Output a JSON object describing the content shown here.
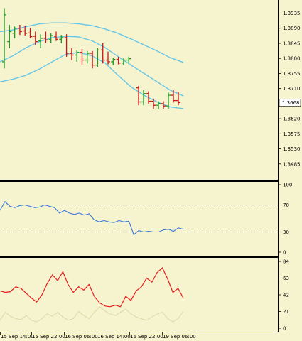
{
  "chart_data": [
    {
      "type": "ohlc",
      "panel": "price",
      "ylim": [
        1.344,
        1.397
      ],
      "y_ticks": [
        "1.3935",
        "1.3890",
        "1.3845",
        "1.3800",
        "1.3755",
        "1.3710",
        "1.3665",
        "1.3620",
        "1.3575",
        "1.3530",
        "1.3485"
      ],
      "y_tick_values": [
        1.3935,
        1.389,
        1.3845,
        1.38,
        1.3755,
        1.371,
        1.3665,
        1.362,
        1.3575,
        1.353,
        1.3485
      ],
      "current_price": "1.3668",
      "current_price_value": 1.3668,
      "colors": {
        "up": "#1f9a1f",
        "down": "#d31414",
        "band": "#69c7e6",
        "price_label_bg": "#ffffff"
      },
      "bars": [
        {
          "o": 1.379,
          "h": 1.395,
          "l": 1.377,
          "c": 1.393
        },
        {
          "o": 1.385,
          "h": 1.39,
          "l": 1.383,
          "c": 1.388
        },
        {
          "o": 1.3875,
          "h": 1.3895,
          "l": 1.386,
          "c": 1.389
        },
        {
          "o": 1.389,
          "h": 1.39,
          "l": 1.387,
          "c": 1.388
        },
        {
          "o": 1.3882,
          "h": 1.3898,
          "l": 1.3868,
          "c": 1.3875
        },
        {
          "o": 1.3876,
          "h": 1.389,
          "l": 1.386,
          "c": 1.3865
        },
        {
          "o": 1.3866,
          "h": 1.388,
          "l": 1.384,
          "c": 1.385
        },
        {
          "o": 1.3852,
          "h": 1.3872,
          "l": 1.383,
          "c": 1.386
        },
        {
          "o": 1.386,
          "h": 1.388,
          "l": 1.3846,
          "c": 1.3855
        },
        {
          "o": 1.3856,
          "h": 1.3875,
          "l": 1.3845,
          "c": 1.3868
        },
        {
          "o": 1.3866,
          "h": 1.388,
          "l": 1.3852,
          "c": 1.3857
        },
        {
          "o": 1.3857,
          "h": 1.387,
          "l": 1.3845,
          "c": 1.3862
        },
        {
          "o": 1.3862,
          "h": 1.3872,
          "l": 1.3805,
          "c": 1.3815
        },
        {
          "o": 1.3815,
          "h": 1.383,
          "l": 1.3795,
          "c": 1.381
        },
        {
          "o": 1.381,
          "h": 1.3825,
          "l": 1.379,
          "c": 1.3818
        },
        {
          "o": 1.3818,
          "h": 1.3828,
          "l": 1.378,
          "c": 1.3795
        },
        {
          "o": 1.3795,
          "h": 1.3822,
          "l": 1.3785,
          "c": 1.3815
        },
        {
          "o": 1.3815,
          "h": 1.3822,
          "l": 1.377,
          "c": 1.378
        },
        {
          "o": 1.378,
          "h": 1.383,
          "l": 1.3775,
          "c": 1.3825
        },
        {
          "o": 1.3825,
          "h": 1.3845,
          "l": 1.3785,
          "c": 1.3795
        },
        {
          "o": 1.3795,
          "h": 1.382,
          "l": 1.3782,
          "c": 1.379
        },
        {
          "o": 1.379,
          "h": 1.3802,
          "l": 1.378,
          "c": 1.3797
        },
        {
          "o": 1.3797,
          "h": 1.3805,
          "l": 1.3782,
          "c": 1.3786
        },
        {
          "o": 1.3786,
          "h": 1.38,
          "l": 1.378,
          "c": 1.3795
        },
        {
          "o": 1.3795,
          "h": 1.3805,
          "l": 1.3785,
          "c": 1.3799
        },
        {
          "o": 1.3712,
          "h": 1.3718,
          "l": 1.366,
          "c": 1.367
        },
        {
          "o": 1.367,
          "h": 1.3705,
          "l": 1.366,
          "c": 1.3695
        },
        {
          "o": 1.3695,
          "h": 1.3702,
          "l": 1.3665,
          "c": 1.3672
        },
        {
          "o": 1.3672,
          "h": 1.368,
          "l": 1.365,
          "c": 1.366
        },
        {
          "o": 1.366,
          "h": 1.3672,
          "l": 1.3648,
          "c": 1.3665
        },
        {
          "o": 1.3665,
          "h": 1.3672,
          "l": 1.365,
          "c": 1.3658
        },
        {
          "o": 1.3658,
          "h": 1.3698,
          "l": 1.365,
          "c": 1.369
        },
        {
          "o": 1.369,
          "h": 1.3705,
          "l": 1.3668,
          "c": 1.3674
        },
        {
          "o": 1.3674,
          "h": 1.37,
          "l": 1.366,
          "c": 1.3668
        }
      ],
      "bands": {
        "upper": [
          1.388,
          1.3885,
          1.3895,
          1.3903,
          1.3906,
          1.3906,
          1.3903,
          1.3898,
          1.3888,
          1.3875,
          1.3858,
          1.384,
          1.3822,
          1.3802,
          1.3788
        ],
        "middle": [
          1.379,
          1.3808,
          1.3832,
          1.385,
          1.3862,
          1.3866,
          1.3864,
          1.3853,
          1.3833,
          1.3806,
          1.378,
          1.3755,
          1.373,
          1.3705,
          1.3688
        ],
        "lower": [
          1.373,
          1.3738,
          1.375,
          1.3768,
          1.379,
          1.3812,
          1.3818,
          1.3808,
          1.3787,
          1.375,
          1.3715,
          1.369,
          1.367,
          1.3655,
          1.365
        ]
      }
    },
    {
      "type": "line",
      "panel": "indicator-1",
      "ylim": [
        0,
        100
      ],
      "y_ticks": [
        "100",
        "70",
        "30",
        "0"
      ],
      "y_tick_values": [
        100,
        70,
        30,
        0
      ],
      "levels": [
        70,
        30
      ],
      "series": [
        {
          "color": "#3a78d6",
          "values": [
            62,
            75,
            68,
            66,
            69,
            70,
            68,
            66,
            67,
            70,
            68,
            66,
            58,
            62,
            58,
            56,
            58,
            55,
            57,
            48,
            45,
            47,
            45,
            44,
            47,
            45,
            46,
            26,
            32,
            30,
            31,
            30,
            30,
            33,
            34,
            31,
            36,
            34
          ]
        }
      ]
    },
    {
      "type": "line",
      "panel": "indicator-2",
      "ylim": [
        0,
        84
      ],
      "y_ticks": [
        "84",
        "63",
        "42",
        "21",
        "0"
      ],
      "y_tick_values": [
        84,
        63,
        42,
        21,
        0
      ],
      "series": [
        {
          "color": "#e51d1d",
          "values": [
            47,
            45,
            46,
            52,
            50,
            44,
            38,
            33,
            42,
            56,
            67,
            60,
            71,
            55,
            45,
            52,
            48,
            55,
            40,
            32,
            28,
            27,
            29,
            27,
            40,
            35,
            47,
            52,
            63,
            58,
            70,
            76,
            62,
            45,
            50,
            38
          ]
        },
        {
          "color": "#ddd8a8",
          "values": [
            10,
            20,
            15,
            12,
            11,
            16,
            10,
            8,
            12,
            18,
            15,
            20,
            14,
            10,
            12,
            21,
            16,
            12,
            20,
            27,
            22,
            18,
            16,
            20,
            24,
            18,
            14,
            12,
            10,
            14,
            18,
            20,
            12,
            8,
            12,
            21
          ]
        }
      ]
    }
  ],
  "x_axis": {
    "labels": [
      "15 Sep 14:00",
      "15 Sep 22:00",
      "16 Sep 06:00",
      "16 Sep 14:00",
      "16 Sep 22:00",
      "19 Sep 06:00"
    ]
  }
}
